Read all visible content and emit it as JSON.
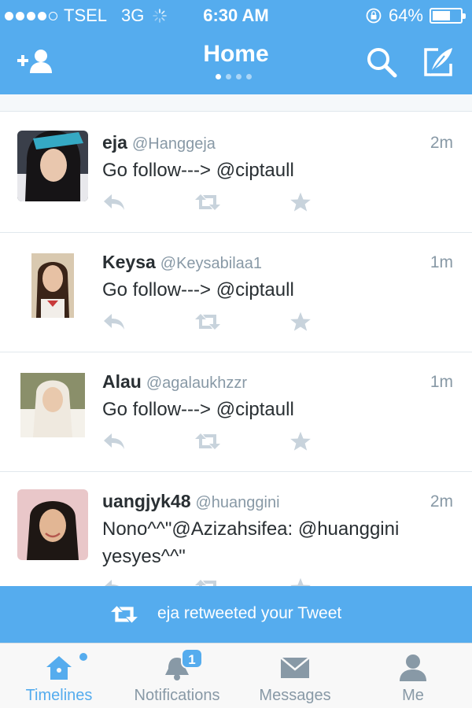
{
  "status_bar": {
    "carrier": "TSEL",
    "network": "3G",
    "time": "6:30 AM",
    "battery_percent": "64%",
    "battery_level": 0.64,
    "signal_bars": 4
  },
  "nav": {
    "title": "Home",
    "page_count": 4,
    "active_page": 1,
    "left_icon": "add-user-icon",
    "right_icons": [
      "search-icon",
      "compose-icon"
    ]
  },
  "tweets": [
    {
      "name": "eja",
      "handle": "@Hanggeja",
      "time": "2m",
      "text": "Go follow---> @ciptaull"
    },
    {
      "name": "Keysa",
      "handle": "@Keysabilaa1",
      "time": "1m",
      "text": "Go follow---> @ciptaull"
    },
    {
      "name": "Alau",
      "handle": "@agalaukhzzr",
      "time": "1m",
      "text": "Go follow---> @ciptaull"
    },
    {
      "name": "uangjyk48",
      "handle": "@huanggini",
      "time": "2m",
      "text": "Nono^^\"@Azizahsifea: @huanggini yesyes^^\""
    }
  ],
  "banner": {
    "text": "eja retweeted your Tweet",
    "icon": "retweet-icon"
  },
  "tabs": [
    {
      "label": "Timelines",
      "icon": "home-icon",
      "active": true
    },
    {
      "label": "Notifications",
      "icon": "bell-icon",
      "badge": "1"
    },
    {
      "label": "Messages",
      "icon": "envelope-icon"
    },
    {
      "label": "Me",
      "icon": "person-icon"
    }
  ],
  "colors": {
    "brand": "#55acee",
    "text": "#292f33",
    "muted": "#8899a6",
    "action_icon": "#c8d3dc"
  }
}
